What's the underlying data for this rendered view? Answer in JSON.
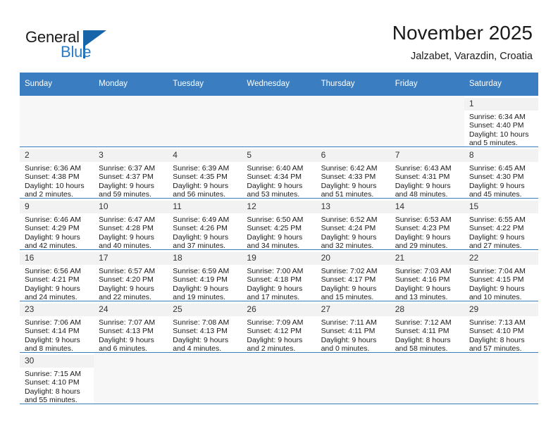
{
  "brand": {
    "word_one": "General",
    "word_two": "Blue",
    "flag_icon": "triangle-flag-icon",
    "accent_color": "#2b7cc4",
    "flag_color": "#1565a8"
  },
  "header": {
    "month_title": "November 2025",
    "location": "Jalzabet, Varazdin, Croatia",
    "header_bg_color": "#3a7dc0"
  },
  "calendar": {
    "weekdays": [
      "Sunday",
      "Monday",
      "Tuesday",
      "Wednesday",
      "Thursday",
      "Friday",
      "Saturday"
    ],
    "weeks": [
      [
        {
          "empty": true
        },
        {
          "empty": true
        },
        {
          "empty": true
        },
        {
          "empty": true
        },
        {
          "empty": true
        },
        {
          "empty": true
        },
        {
          "day": "1",
          "sunrise": "Sunrise: 6:34 AM",
          "sunset": "Sunset: 4:40 PM",
          "daylight_1": "Daylight: 10 hours",
          "daylight_2": "and 5 minutes."
        }
      ],
      [
        {
          "day": "2",
          "sunrise": "Sunrise: 6:36 AM",
          "sunset": "Sunset: 4:38 PM",
          "daylight_1": "Daylight: 10 hours",
          "daylight_2": "and 2 minutes."
        },
        {
          "day": "3",
          "sunrise": "Sunrise: 6:37 AM",
          "sunset": "Sunset: 4:37 PM",
          "daylight_1": "Daylight: 9 hours",
          "daylight_2": "and 59 minutes."
        },
        {
          "day": "4",
          "sunrise": "Sunrise: 6:39 AM",
          "sunset": "Sunset: 4:35 PM",
          "daylight_1": "Daylight: 9 hours",
          "daylight_2": "and 56 minutes."
        },
        {
          "day": "5",
          "sunrise": "Sunrise: 6:40 AM",
          "sunset": "Sunset: 4:34 PM",
          "daylight_1": "Daylight: 9 hours",
          "daylight_2": "and 53 minutes."
        },
        {
          "day": "6",
          "sunrise": "Sunrise: 6:42 AM",
          "sunset": "Sunset: 4:33 PM",
          "daylight_1": "Daylight: 9 hours",
          "daylight_2": "and 51 minutes."
        },
        {
          "day": "7",
          "sunrise": "Sunrise: 6:43 AM",
          "sunset": "Sunset: 4:31 PM",
          "daylight_1": "Daylight: 9 hours",
          "daylight_2": "and 48 minutes."
        },
        {
          "day": "8",
          "sunrise": "Sunrise: 6:45 AM",
          "sunset": "Sunset: 4:30 PM",
          "daylight_1": "Daylight: 9 hours",
          "daylight_2": "and 45 minutes."
        }
      ],
      [
        {
          "day": "9",
          "sunrise": "Sunrise: 6:46 AM",
          "sunset": "Sunset: 4:29 PM",
          "daylight_1": "Daylight: 9 hours",
          "daylight_2": "and 42 minutes."
        },
        {
          "day": "10",
          "sunrise": "Sunrise: 6:47 AM",
          "sunset": "Sunset: 4:28 PM",
          "daylight_1": "Daylight: 9 hours",
          "daylight_2": "and 40 minutes."
        },
        {
          "day": "11",
          "sunrise": "Sunrise: 6:49 AM",
          "sunset": "Sunset: 4:26 PM",
          "daylight_1": "Daylight: 9 hours",
          "daylight_2": "and 37 minutes."
        },
        {
          "day": "12",
          "sunrise": "Sunrise: 6:50 AM",
          "sunset": "Sunset: 4:25 PM",
          "daylight_1": "Daylight: 9 hours",
          "daylight_2": "and 34 minutes."
        },
        {
          "day": "13",
          "sunrise": "Sunrise: 6:52 AM",
          "sunset": "Sunset: 4:24 PM",
          "daylight_1": "Daylight: 9 hours",
          "daylight_2": "and 32 minutes."
        },
        {
          "day": "14",
          "sunrise": "Sunrise: 6:53 AM",
          "sunset": "Sunset: 4:23 PM",
          "daylight_1": "Daylight: 9 hours",
          "daylight_2": "and 29 minutes."
        },
        {
          "day": "15",
          "sunrise": "Sunrise: 6:55 AM",
          "sunset": "Sunset: 4:22 PM",
          "daylight_1": "Daylight: 9 hours",
          "daylight_2": "and 27 minutes."
        }
      ],
      [
        {
          "day": "16",
          "sunrise": "Sunrise: 6:56 AM",
          "sunset": "Sunset: 4:21 PM",
          "daylight_1": "Daylight: 9 hours",
          "daylight_2": "and 24 minutes."
        },
        {
          "day": "17",
          "sunrise": "Sunrise: 6:57 AM",
          "sunset": "Sunset: 4:20 PM",
          "daylight_1": "Daylight: 9 hours",
          "daylight_2": "and 22 minutes."
        },
        {
          "day": "18",
          "sunrise": "Sunrise: 6:59 AM",
          "sunset": "Sunset: 4:19 PM",
          "daylight_1": "Daylight: 9 hours",
          "daylight_2": "and 19 minutes."
        },
        {
          "day": "19",
          "sunrise": "Sunrise: 7:00 AM",
          "sunset": "Sunset: 4:18 PM",
          "daylight_1": "Daylight: 9 hours",
          "daylight_2": "and 17 minutes."
        },
        {
          "day": "20",
          "sunrise": "Sunrise: 7:02 AM",
          "sunset": "Sunset: 4:17 PM",
          "daylight_1": "Daylight: 9 hours",
          "daylight_2": "and 15 minutes."
        },
        {
          "day": "21",
          "sunrise": "Sunrise: 7:03 AM",
          "sunset": "Sunset: 4:16 PM",
          "daylight_1": "Daylight: 9 hours",
          "daylight_2": "and 13 minutes."
        },
        {
          "day": "22",
          "sunrise": "Sunrise: 7:04 AM",
          "sunset": "Sunset: 4:15 PM",
          "daylight_1": "Daylight: 9 hours",
          "daylight_2": "and 10 minutes."
        }
      ],
      [
        {
          "day": "23",
          "sunrise": "Sunrise: 7:06 AM",
          "sunset": "Sunset: 4:14 PM",
          "daylight_1": "Daylight: 9 hours",
          "daylight_2": "and 8 minutes."
        },
        {
          "day": "24",
          "sunrise": "Sunrise: 7:07 AM",
          "sunset": "Sunset: 4:13 PM",
          "daylight_1": "Daylight: 9 hours",
          "daylight_2": "and 6 minutes."
        },
        {
          "day": "25",
          "sunrise": "Sunrise: 7:08 AM",
          "sunset": "Sunset: 4:13 PM",
          "daylight_1": "Daylight: 9 hours",
          "daylight_2": "and 4 minutes."
        },
        {
          "day": "26",
          "sunrise": "Sunrise: 7:09 AM",
          "sunset": "Sunset: 4:12 PM",
          "daylight_1": "Daylight: 9 hours",
          "daylight_2": "and 2 minutes."
        },
        {
          "day": "27",
          "sunrise": "Sunrise: 7:11 AM",
          "sunset": "Sunset: 4:11 PM",
          "daylight_1": "Daylight: 9 hours",
          "daylight_2": "and 0 minutes."
        },
        {
          "day": "28",
          "sunrise": "Sunrise: 7:12 AM",
          "sunset": "Sunset: 4:11 PM",
          "daylight_1": "Daylight: 8 hours",
          "daylight_2": "and 58 minutes."
        },
        {
          "day": "29",
          "sunrise": "Sunrise: 7:13 AM",
          "sunset": "Sunset: 4:10 PM",
          "daylight_1": "Daylight: 8 hours",
          "daylight_2": "and 57 minutes."
        }
      ],
      [
        {
          "day": "30",
          "sunrise": "Sunrise: 7:15 AM",
          "sunset": "Sunset: 4:10 PM",
          "daylight_1": "Daylight: 8 hours",
          "daylight_2": "and 55 minutes."
        },
        {
          "empty": true
        },
        {
          "empty": true
        },
        {
          "empty": true
        },
        {
          "empty": true
        },
        {
          "empty": true
        },
        {
          "empty": true
        }
      ]
    ]
  }
}
